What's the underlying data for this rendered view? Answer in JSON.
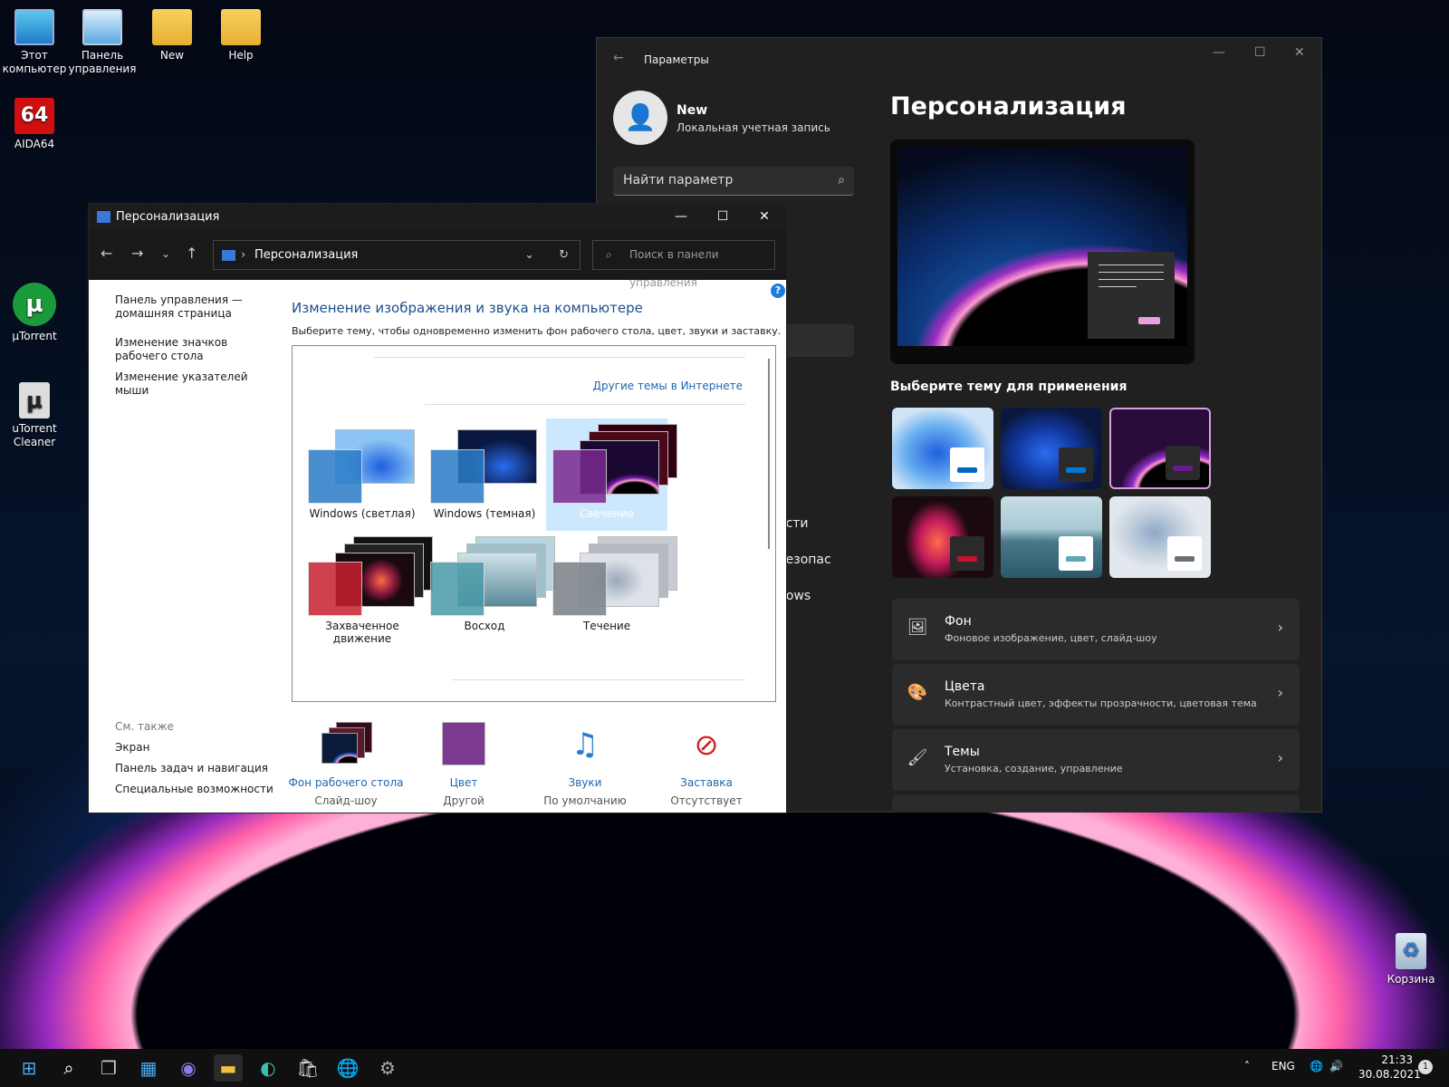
{
  "desktop": {
    "icons": [
      {
        "label": "Этот компьютер",
        "icon": "computer-icon"
      },
      {
        "label": "Панель управления",
        "icon": "control-panel-icon"
      },
      {
        "label": "New",
        "icon": "folder-icon"
      },
      {
        "label": "Help",
        "icon": "folder-icon"
      },
      {
        "label": "AIDA64",
        "icon": "aida64-icon",
        "glyph": "64"
      },
      {
        "label": "µTorrent",
        "icon": "utorrent-icon",
        "glyph": "µ"
      },
      {
        "label": "uTorrent Cleaner",
        "icon": "utorrent-cleaner-icon",
        "glyph": "µ"
      },
      {
        "label": "Корзина",
        "icon": "recycle-bin-icon",
        "glyph": "♻"
      }
    ]
  },
  "settings": {
    "window_title": "Параметры",
    "user_name": "New",
    "account_type": "Локальная учетная запись",
    "search_placeholder": "Найти параметр",
    "page_title": "Персонализация",
    "choose_theme_label": "Выберите тему для применения",
    "partial_nav": [
      "ости",
      "безопас",
      "dows"
    ],
    "theme_thumbnails": [
      {
        "name": "windows-light",
        "accent": "#0067c0"
      },
      {
        "name": "windows-dark",
        "accent": "#0078d4"
      },
      {
        "name": "glow",
        "accent": "#6b1a8c",
        "selected": true
      },
      {
        "name": "captured-motion",
        "accent": "#c8102e"
      },
      {
        "name": "sunrise",
        "accent": "#5aa7b8"
      },
      {
        "name": "flow",
        "accent": "#6a6f78"
      }
    ],
    "cards": [
      {
        "title": "Фон",
        "subtitle": "Фоновое изображение, цвет, слайд-шоу",
        "icon": "image-icon"
      },
      {
        "title": "Цвета",
        "subtitle": "Контрастный цвет, эффекты прозрачности, цветовая тема",
        "icon": "palette-icon"
      },
      {
        "title": "Темы",
        "subtitle": "Установка, создание, управление",
        "icon": "brush-icon"
      }
    ]
  },
  "control_panel": {
    "window_title": "Персонализация",
    "address": "Персонализация",
    "search_placeholder": "Поиск в панели управления",
    "left_links": [
      "Панель управления — домашняя страница",
      "Изменение значков рабочего стола",
      "Изменение указателей мыши"
    ],
    "see_also_title": "См. также",
    "see_also": [
      "Экран",
      "Панель задач и навигация",
      "Специальные возможности"
    ],
    "heading": "Изменение изображения и звука на компьютере",
    "description": "Выберите тему, чтобы одновременно изменить фон рабочего стола, цвет, звуки и заставку.",
    "online_themes_link": "Другие темы в Интернете",
    "themes": [
      {
        "name": "Windows (светлая)",
        "selected": false
      },
      {
        "name": "Windows (темная)",
        "selected": false
      },
      {
        "name": "Свечение",
        "selected": true
      },
      {
        "name": "Захваченное движение",
        "selected": false
      },
      {
        "name": "Восход",
        "selected": false
      },
      {
        "name": "Течение",
        "selected": false
      }
    ],
    "bottom": [
      {
        "label": "Фон рабочего стола",
        "value": "Слайд-шоу"
      },
      {
        "label": "Цвет",
        "value": "Другой"
      },
      {
        "label": "Звуки",
        "value": "По умолчанию"
      },
      {
        "label": "Заставка",
        "value": "Отсутствует"
      }
    ]
  },
  "taskbar": {
    "language": "ENG",
    "time": "21:33",
    "date": "30.08.2021",
    "notification_count": "1"
  }
}
